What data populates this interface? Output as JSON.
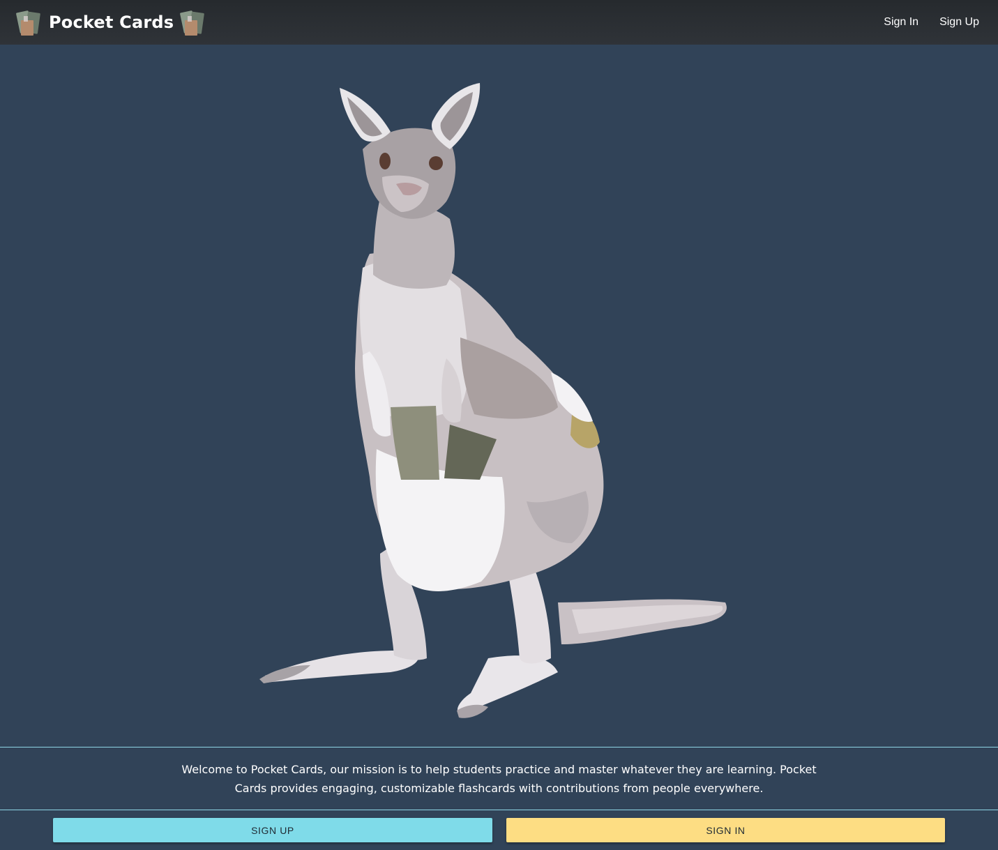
{
  "app": {
    "title": "Pocket Cards"
  },
  "nav": {
    "sign_in": "Sign In",
    "sign_up": "Sign Up"
  },
  "hero": {
    "illustration_icon": "kangaroo-illustration"
  },
  "mission": {
    "text": "Welcome to Pocket Cards, our mission is to help students practice and master whatever they are learning. Pocket Cards provides engaging, customizable flashcards with contributions from people everywhere."
  },
  "actions": {
    "sign_up": "SIGN UP",
    "sign_in": "SIGN IN"
  },
  "colors": {
    "background": "#314358",
    "navbar": "#2b2f33",
    "accent_line": "#8fd6e6",
    "signup_button": "#7fdbe9",
    "signin_button": "#fddd83"
  }
}
